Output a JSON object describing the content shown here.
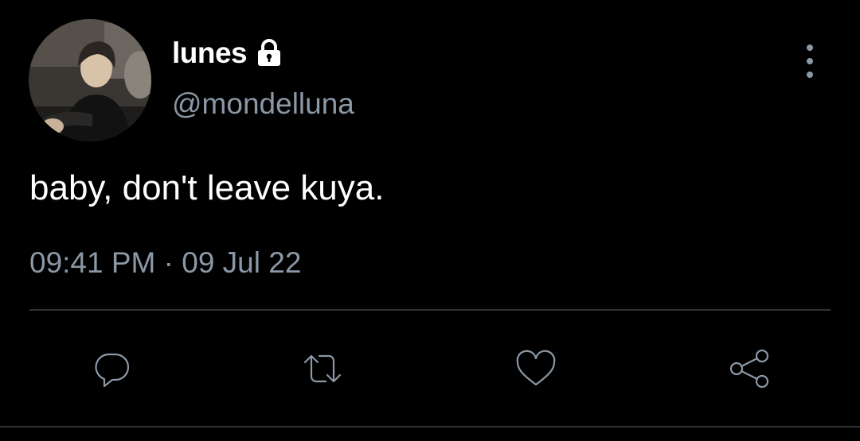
{
  "tweet": {
    "author": {
      "display_name": "lunes",
      "handle": "@mondelluna",
      "protected": true,
      "avatar": "profile-photo"
    },
    "text": "baby, don't leave kuya.",
    "timestamp": "09:41 PM · 09 Jul 22"
  },
  "actions": {
    "reply_icon": "speech-bubble",
    "retweet_icon": "retweet-arrows",
    "like_icon": "heart",
    "share_icon": "share-nodes",
    "more_icon": "vertical-ellipsis"
  },
  "theme": {
    "background": "#000000",
    "text_primary": "#ffffff",
    "text_secondary": "#8b98a5",
    "divider": "#2f3336"
  }
}
